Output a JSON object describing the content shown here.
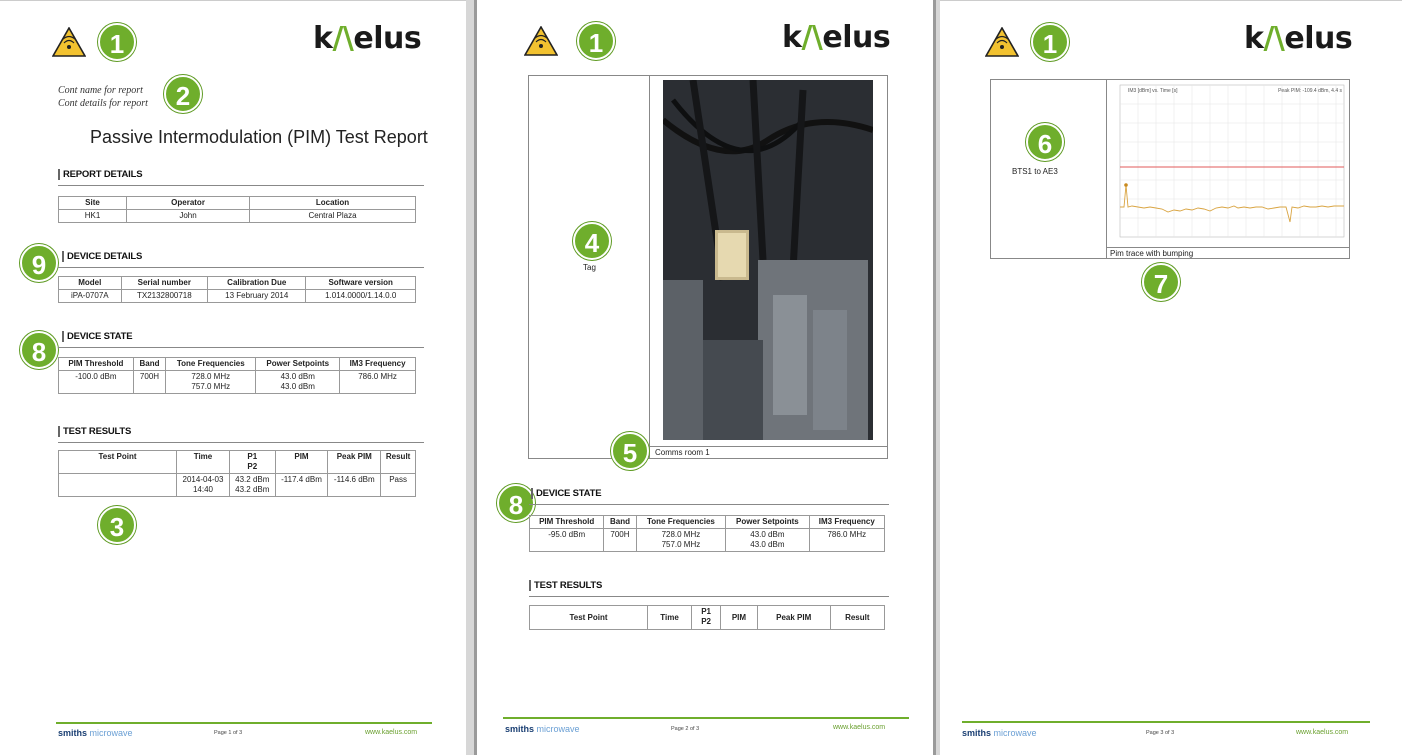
{
  "logo": {
    "prefix": "k",
    "mark": "/\\",
    "suffix": "elus"
  },
  "callouts": {
    "c1": "1",
    "c2": "2",
    "c3": "3",
    "c4": "4",
    "c5": "5",
    "c6": "6",
    "c7": "7",
    "c8": "8",
    "c9": "9"
  },
  "page1": {
    "cont_name": "Cont name for report",
    "cont_details": "Cont details for report",
    "title": "Passive Intermodulation (PIM) Test Report",
    "report_details": {
      "heading": "REPORT DETAILS",
      "headers": [
        "Site",
        "Operator",
        "Location"
      ],
      "row": [
        "HK1",
        "John",
        "Central Plaza"
      ]
    },
    "device_details": {
      "heading": "DEVICE DETAILS",
      "headers": [
        "Model",
        "Serial number",
        "Calibration Due",
        "Software version"
      ],
      "row": [
        "iPA-0707A",
        "TX2132800718",
        "13 February 2014",
        "1.014.0000/1.14.0.0"
      ]
    },
    "device_state": {
      "heading": "DEVICE STATE",
      "headers": [
        "PIM Threshold",
        "Band",
        "Tone Frequencies",
        "Power Setpoints",
        "IM3 Frequency"
      ],
      "row": [
        "-100.0 dBm",
        "700H",
        "728.0 MHz",
        "757.0 MHz",
        "43.0 dBm",
        "43.0 dBm",
        "786.0 MHz"
      ]
    },
    "test_results": {
      "heading": "TEST RESULTS",
      "headers": [
        "Test Point",
        "Time",
        "P1",
        "P2",
        "PIM",
        "Peak PIM",
        "Result"
      ],
      "row": [
        "",
        "2014-04-03",
        "14:40",
        "43.2 dBm",
        "43.2 dBm",
        "-117.4 dBm",
        "-114.6 dBm",
        "Pass"
      ]
    },
    "footer": {
      "brand": "smiths",
      "brand2": "microwave",
      "page": "Page 1 of 3",
      "url": "www.kaelus.com"
    }
  },
  "page2": {
    "tag_label": "Tag",
    "photo_caption": "Comms room 1",
    "device_state": {
      "heading": "DEVICE STATE",
      "headers": [
        "PIM Threshold",
        "Band",
        "Tone Frequencies",
        "Power Setpoints",
        "IM3 Frequency"
      ],
      "row": [
        "-95.0 dBm",
        "700H",
        "728.0 MHz",
        "757.0 MHz",
        "43.0 dBm",
        "43.0 dBm",
        "786.0 MHz"
      ]
    },
    "test_results": {
      "heading": "TEST RESULTS",
      "headers": [
        "Test Point",
        "Time",
        "P1",
        "P2",
        "PIM",
        "Peak PIM",
        "Result"
      ]
    },
    "footer": {
      "brand": "smiths",
      "brand2": "microwave",
      "page": "Page 2 of 3",
      "url": "www.kaelus.com"
    }
  },
  "page3": {
    "trace_label": "BTS1 to AE3",
    "chart_caption": "Pim trace with bumping",
    "chart_title": "IM3 [dBm] vs. Time [s]",
    "chart_peak": "Peak PIM: -109.4 dBm, 4.4 s",
    "footer": {
      "brand": "smiths",
      "brand2": "microwave",
      "page": "Page 3 of 3",
      "url": "www.kaelus.com"
    }
  },
  "colors": {
    "accent_green": "#6fae2c",
    "threshold_red": "#e05a5a",
    "trace_orange": "#d9a441"
  }
}
